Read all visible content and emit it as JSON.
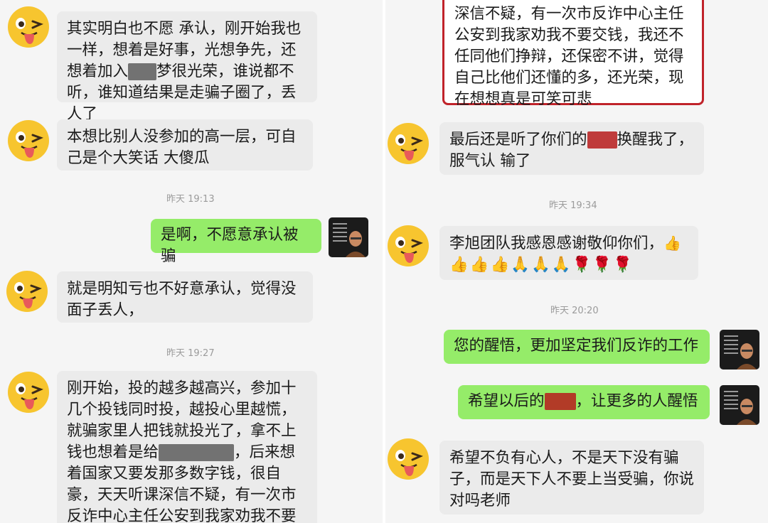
{
  "left": {
    "msg1": {
      "part1": "其实明白也不愿 承认，刚开始我也一样，想着是好事，光想争先，还想着加入",
      "part2": "梦很光荣，谁说都不听，谁知道结果是走骗子圈了，丢人了"
    },
    "msg2": "本想比别人没参加的高一层，可自己是个大笑话 大傻瓜",
    "ts1": "昨天 19:13",
    "msg3": "是啊，不愿意承认被骗",
    "msg4": "就是明知亏也不好意承认，觉得没面子丢人，",
    "ts2": "昨天 19:27",
    "msg5": {
      "part1": "刚开始，投的越多越高兴，参加十几个投钱同时投，越投心里越慌，就骗家里人把钱就投光了，拿不上钱也想着是给",
      "part2": "，后来想着国家又要发那多数字钱，很自豪，天天听课深信不疑，有一次市反诈中心主任公安到我家劝我不要交钱，我还不任同"
    }
  },
  "right": {
    "msg1": "深信不疑，有一次市反诈中心主任公安到我家劝我不要交钱，我还不任同他们挣辩，还保密不讲，觉得自己比他们还懂的多，还光荣，现在想想真是可笑可悲",
    "msg2": {
      "part1": "最后还是听了你们的",
      "part2": "换醒我了，服气认 输了"
    },
    "ts1": "昨天 19:34",
    "msg3": "李旭团队我感恩感谢敬仰你们，",
    "msg3_emojis": "👍👍👍🙏🙏🙏🌹🌹🌹",
    "ts2": "昨天 20:20",
    "msg4": "您的醒悟，更加坚定我们反诈的工作",
    "msg5": {
      "part1": "希望以后的",
      "part2": "，让更多的人醒悟"
    },
    "msg6": "希望不负有心人，不是天下没有骗子，而是天下人不要上当受骗，你说对吗老师"
  }
}
